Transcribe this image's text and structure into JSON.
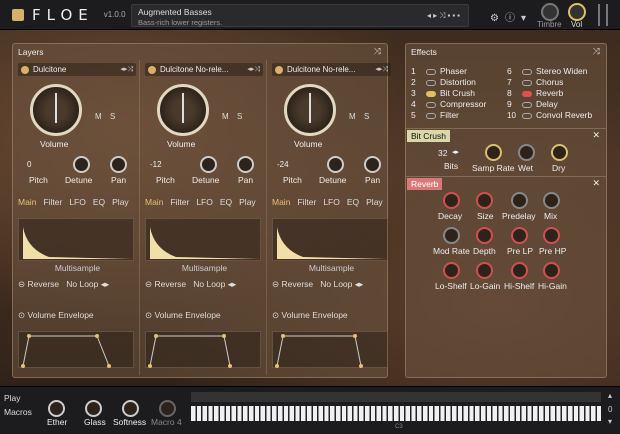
{
  "app": {
    "logo": "FLOE",
    "version": "v1.0.0"
  },
  "preset": {
    "name": "Augmented Basses",
    "description": "Bass-rich lower registers."
  },
  "top": {
    "timbre_label": "Timbre",
    "vol_label": "Vol"
  },
  "layers": {
    "title": "Layers",
    "columns": [
      {
        "name": "Dulcitone",
        "volume": "Volume",
        "pitch_value": "0",
        "pitch": "Pitch",
        "detune": "Detune",
        "pan": "Pan",
        "multisample": "Multisample",
        "reverse": "Reverse",
        "loop": "No Loop",
        "envelope": "Volume Envelope"
      },
      {
        "name": "Dulcitone No-rele...",
        "volume": "Volume",
        "pitch_value": "-12",
        "pitch": "Pitch",
        "detune": "Detune",
        "pan": "Pan",
        "multisample": "Multisample",
        "reverse": "Reverse",
        "loop": "No Loop",
        "envelope": "Volume Envelope"
      },
      {
        "name": "Dulcitone No-rele...",
        "volume": "Volume",
        "pitch_value": "-24",
        "pitch": "Pitch",
        "detune": "Detune",
        "pan": "Pan",
        "multisample": "Multisample",
        "reverse": "Reverse",
        "loop": "No Loop",
        "envelope": "Volume Envelope"
      }
    ],
    "tabs": [
      "Main",
      "Filter",
      "LFO",
      "EQ",
      "Play"
    ],
    "ms": {
      "m": "M",
      "s": "S"
    }
  },
  "effects": {
    "title": "Effects",
    "left": [
      {
        "n": "1",
        "label": "Phaser"
      },
      {
        "n": "2",
        "label": "Distortion"
      },
      {
        "n": "3",
        "label": "Bit Crush"
      },
      {
        "n": "4",
        "label": "Compressor"
      },
      {
        "n": "5",
        "label": "Filter"
      }
    ],
    "right": [
      {
        "n": "6",
        "label": "Stereo Widen"
      },
      {
        "n": "7",
        "label": "Chorus"
      },
      {
        "n": "8",
        "label": "Reverb"
      },
      {
        "n": "9",
        "label": "Delay"
      },
      {
        "n": "10",
        "label": "Convol Reverb"
      }
    ],
    "bitcrush": {
      "title": "Bit Crush",
      "bits_value": "32",
      "bits": "Bits",
      "samp_rate": "Samp Rate",
      "wet": "Wet",
      "dry": "Dry"
    },
    "reverb": {
      "title": "Reverb",
      "row1": [
        "Decay",
        "Size",
        "Predelay",
        "Mix"
      ],
      "row2": [
        "Mod Rate",
        "Depth",
        "Pre LP",
        "Pre HP"
      ],
      "row3": [
        "Lo-Shelf",
        "Lo-Gain",
        "Hi-Shelf",
        "Hi-Gain"
      ]
    }
  },
  "bottom": {
    "play": "Play",
    "macros": "Macros",
    "macro_labels": [
      "Ether",
      "Glass",
      "Softness",
      "Macro 4"
    ],
    "c3": "C3",
    "octave": "0"
  }
}
